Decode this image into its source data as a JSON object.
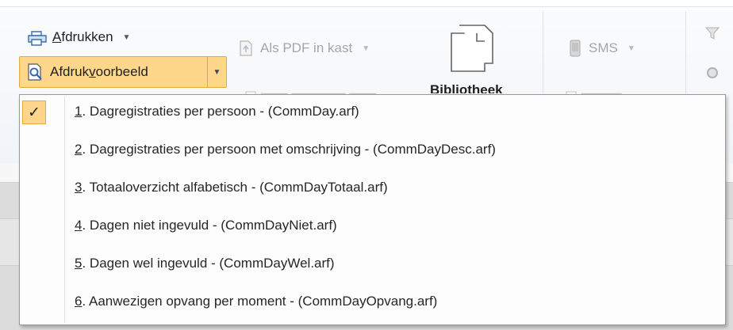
{
  "ribbon": {
    "print_label": "Afdrukken",
    "print_accel": "A",
    "preview_label_pre": "Afdruk",
    "preview_accel": "v",
    "preview_label_post": "oorbeeld",
    "pdf_label": "Als PDF in kast",
    "library_label": "Bibliotheek",
    "sms_label": "SMS"
  },
  "menu": {
    "check_glyph": "✓",
    "items": [
      {
        "num": "1",
        "text": ". Dagregistraties per persoon  -  (CommDay.arf)",
        "checked": true
      },
      {
        "num": "2",
        "text": ". Dagregistraties per persoon met omschrijving  -  (CommDayDesc.arf)",
        "checked": false
      },
      {
        "num": "3",
        "text": ". Totaaloverzicht alfabetisch  -  (CommDayTotaal.arf)",
        "checked": false
      },
      {
        "num": "4",
        "text": ". Dagen niet ingevuld  -  (CommDayNiet.arf)",
        "checked": false
      },
      {
        "num": "5",
        "text": ". Dagen wel ingevuld  -  (CommDayWel.arf)",
        "checked": false
      },
      {
        "num": "6",
        "text": ". Aanwezigen opvang per moment  -  (CommDayOpvang.arf)",
        "checked": false
      }
    ]
  },
  "colors": {
    "highlight_fill": "#ffd78b",
    "highlight_border": "#e9a93a"
  }
}
